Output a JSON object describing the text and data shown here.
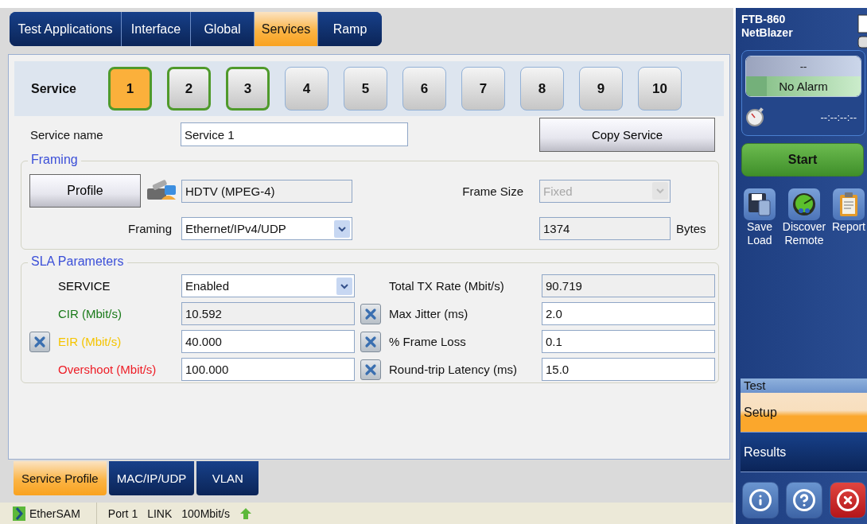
{
  "top_tabs": [
    {
      "label": "Test Applications",
      "selected": false
    },
    {
      "label": "Interface",
      "selected": false
    },
    {
      "label": "Global",
      "selected": false
    },
    {
      "label": "Services",
      "selected": true
    },
    {
      "label": "Ramp",
      "selected": false
    }
  ],
  "service_selector": {
    "label": "Service",
    "services": [
      {
        "label": "1",
        "selected": true,
        "enabled": true
      },
      {
        "label": "2",
        "selected": false,
        "enabled": true
      },
      {
        "label": "3",
        "selected": false,
        "enabled": true
      },
      {
        "label": "4",
        "selected": false,
        "enabled": false
      },
      {
        "label": "5",
        "selected": false,
        "enabled": false
      },
      {
        "label": "6",
        "selected": false,
        "enabled": false
      },
      {
        "label": "7",
        "selected": false,
        "enabled": false
      },
      {
        "label": "8",
        "selected": false,
        "enabled": false
      },
      {
        "label": "9",
        "selected": false,
        "enabled": false
      },
      {
        "label": "10",
        "selected": false,
        "enabled": false
      }
    ]
  },
  "service_name": {
    "label": "Service name",
    "value": "Service 1"
  },
  "copy_button": "Copy Service",
  "framing": {
    "title": "Framing",
    "profile_button": "Profile",
    "profile_value": "HDTV (MPEG-4)",
    "framing_label": "Framing",
    "framing_value": "Ethernet/IPv4/UDP",
    "frame_size_label": "Frame Size",
    "frame_size_value": "Fixed",
    "frame_size_disabled": true,
    "size_value": "1374",
    "size_unit": "Bytes"
  },
  "sla": {
    "title": "SLA Parameters",
    "left": [
      {
        "label": "SERVICE",
        "color": "#000000",
        "kind": "select",
        "value": "Enabled",
        "clear_button": false
      },
      {
        "label": "CIR (Mbit/s)",
        "color": "#1a7a1a",
        "kind": "readonly",
        "value": "10.592",
        "clear_button": false
      },
      {
        "label": "EIR (Mbit/s)",
        "color": "#f5c400",
        "kind": "input",
        "value": "40.000",
        "clear_button": true
      },
      {
        "label": "Overshoot (Mbit/s)",
        "color": "#ee1c25",
        "kind": "input",
        "value": "100.000",
        "clear_button": false
      }
    ],
    "right": [
      {
        "label": "Total TX Rate (Mbit/s)",
        "kind": "readonly",
        "value": "90.719",
        "clear_button": false
      },
      {
        "label": "Max Jitter (ms)",
        "kind": "input",
        "value": "2.0",
        "clear_button": true
      },
      {
        "label": "% Frame Loss",
        "kind": "input",
        "value": "0.1",
        "clear_button": true
      },
      {
        "label": "Round-trip Latency (ms)",
        "kind": "input",
        "value": "15.0",
        "clear_button": true
      }
    ]
  },
  "bottom_tabs": [
    {
      "label": "Service Profile",
      "selected": true
    },
    {
      "label": "MAC/IP/UDP",
      "selected": false
    },
    {
      "label": "VLAN",
      "selected": false
    }
  ],
  "status_bar": {
    "app": "EtherSAM",
    "items": [
      "Port 1",
      "LINK",
      "100Mbit/s"
    ]
  },
  "sidebar": {
    "title": [
      "FTB-860",
      "NetBlazer"
    ],
    "alarm": {
      "top": "--",
      "status": "No Alarm"
    },
    "timer": "--:--:--:--",
    "start_button": "Start",
    "tools": [
      {
        "kind": "save",
        "label": [
          "Save",
          "Load"
        ]
      },
      {
        "kind": "discover",
        "label": [
          "Discover",
          "Remote"
        ]
      },
      {
        "kind": "report",
        "label": [
          "Report"
        ]
      }
    ],
    "test_header": "Test",
    "nav": [
      {
        "label": "Setup",
        "selected": true
      },
      {
        "label": "Results",
        "selected": false
      }
    ],
    "footer_buttons": [
      {
        "kind": "info"
      },
      {
        "kind": "help"
      },
      {
        "kind": "exit"
      }
    ]
  }
}
